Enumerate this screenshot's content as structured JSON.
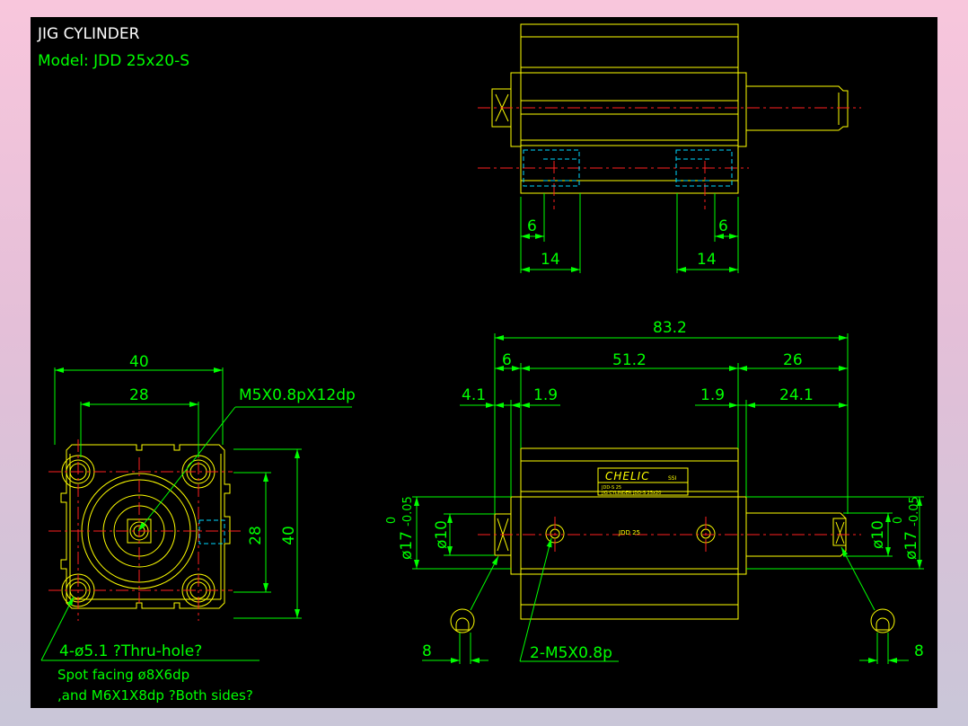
{
  "title": "JIG CYLINDER",
  "model": "Model: JDD 25x20-S",
  "top_view": {
    "dim_left_small": "6",
    "dim_right_small": "6",
    "dim_left_large": "14",
    "dim_right_large": "14"
  },
  "end_view": {
    "dim_width_outer": "40",
    "dim_width_inner": "28",
    "dim_height_inner": "28",
    "dim_height_outer": "40",
    "thread_callout": "M5X0.8pX12dp",
    "hole_callout": "4-ø5.1 ?Thru-hole?",
    "spot_facing": "Spot facing  ø8X6dp",
    "counterbore": ",and M6X1X8dp ?Both sides?"
  },
  "side_view": {
    "dim_overall": "83.2",
    "dim_6": "6",
    "dim_body": "51.2",
    "dim_rod": "26",
    "dim_4_1": "4.1",
    "dim_1_9_left": "1.9",
    "dim_1_9_right": "1.9",
    "dim_24_1": "24.1",
    "dia_left": "ø10",
    "dia_right": "ø10",
    "tol_left": "ø17",
    "tol_right": "ø17",
    "tol_upper": "0",
    "tol_lower": "-0.05",
    "ports": "2-M5X0.8p",
    "dim_8_left": "8",
    "dim_8_right": "8",
    "brand": "CHELIC",
    "brand_suffix": "SSI",
    "label_line1": "JDD-S 25",
    "label_line2": "JIG CYLINDER JDD-S 25x20",
    "body_marking": "JDD 25"
  }
}
